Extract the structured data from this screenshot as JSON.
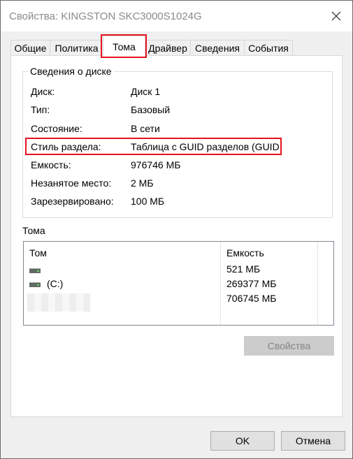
{
  "window": {
    "title": "Свойства: KINGSTON SKC3000S1024G"
  },
  "tabs": [
    {
      "label": "Общие"
    },
    {
      "label": "Политика"
    },
    {
      "label": "Тома"
    },
    {
      "label": "Драйвер"
    },
    {
      "label": "Сведения"
    },
    {
      "label": "События"
    }
  ],
  "active_tab": "Тома",
  "disk_info": {
    "group_title": "Сведения о диске",
    "rows": [
      {
        "label": "Диск:",
        "value": "Диск 1"
      },
      {
        "label": "Тип:",
        "value": "Базовый"
      },
      {
        "label": "Состояние:",
        "value": "В сети"
      },
      {
        "label": "Стиль раздела:",
        "value": "Таблица с GUID разделов (GUID"
      },
      {
        "label": "Емкость:",
        "value": "976746 МБ"
      },
      {
        "label": "Незанятое место:",
        "value": "2 МБ"
      },
      {
        "label": "Зарезервировано:",
        "value": "100 МБ"
      }
    ]
  },
  "volumes": {
    "section_title": "Тома",
    "columns": [
      "Том",
      "Емкость"
    ],
    "rows": [
      {
        "name": "",
        "capacity": "521 МБ",
        "icon": "disk-icon"
      },
      {
        "name": "(C:)",
        "capacity": "269377 МБ",
        "icon": "disk-icon"
      },
      {
        "name": "",
        "capacity": "706745 МБ",
        "icon": ""
      }
    ]
  },
  "buttons": {
    "properties": "Свойства",
    "ok": "OK",
    "cancel": "Отмена"
  },
  "highlight_color": "#e8131f"
}
